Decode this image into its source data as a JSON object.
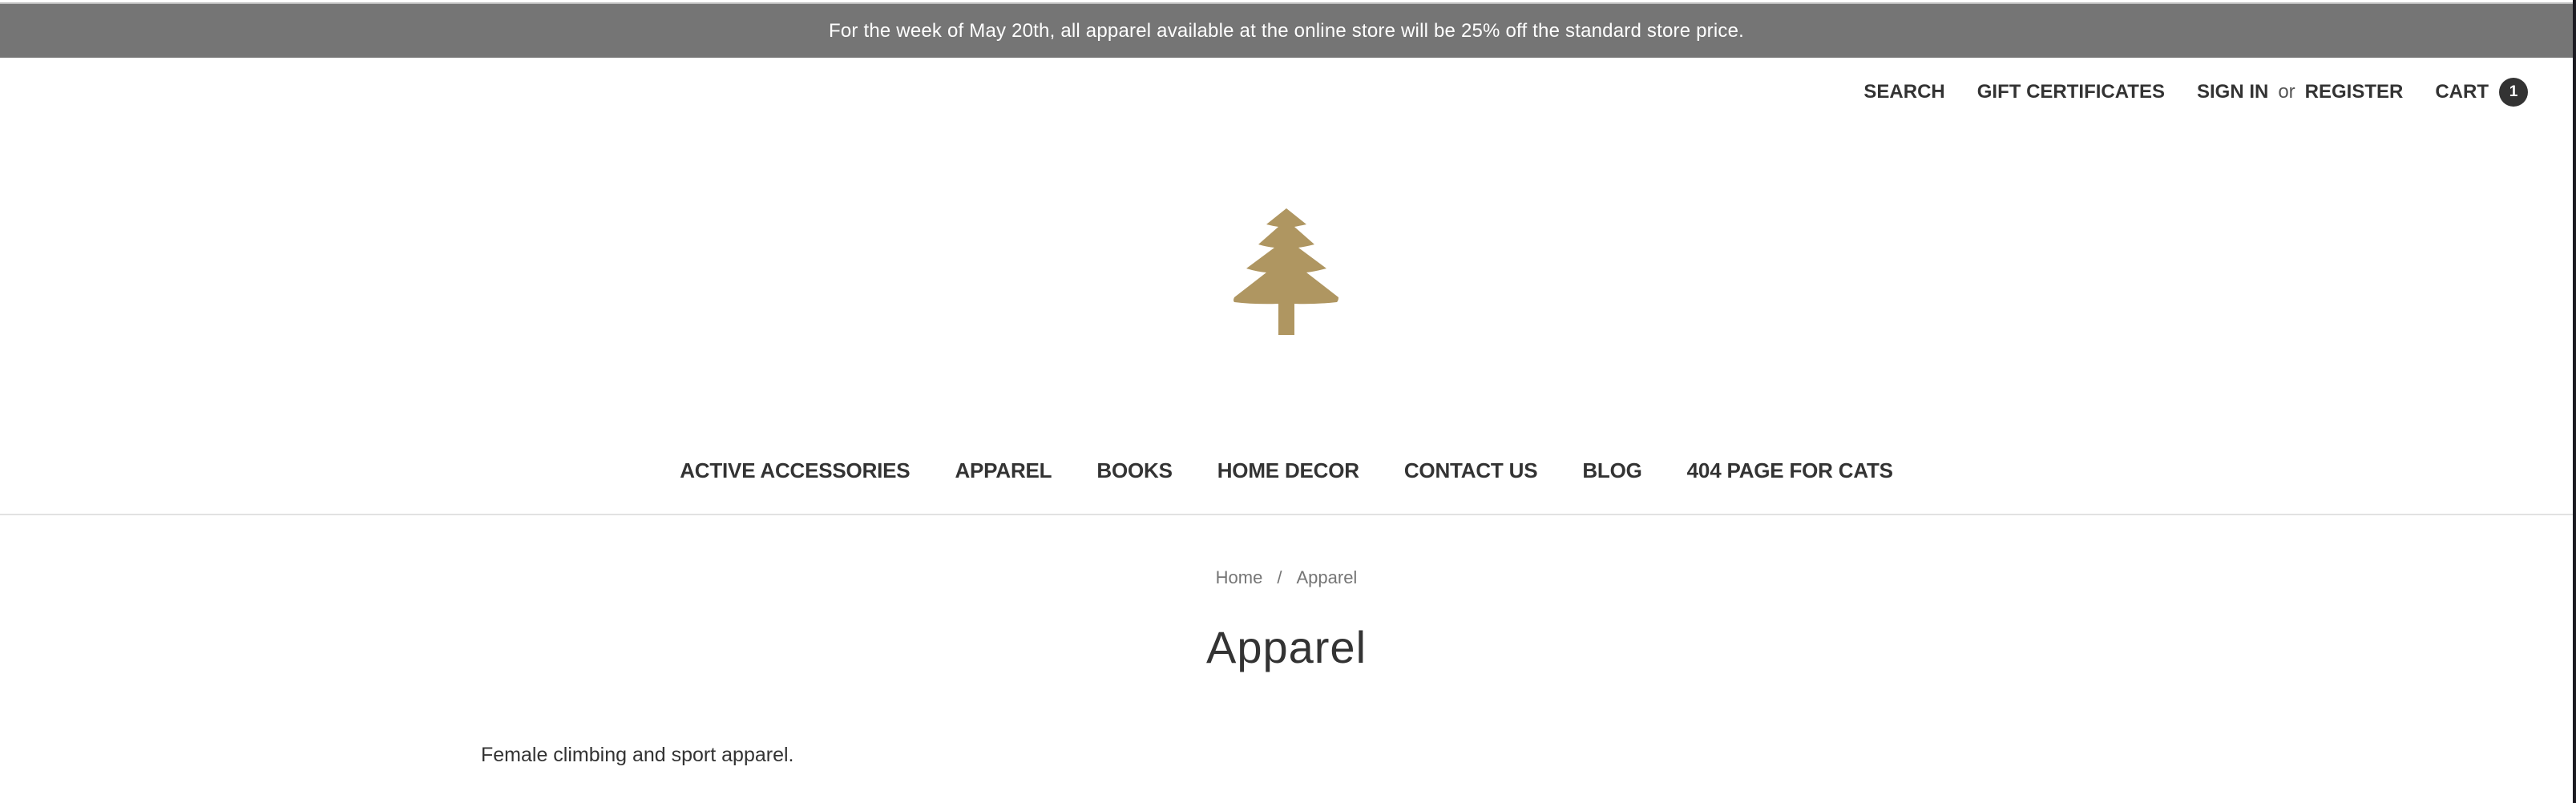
{
  "banner": {
    "text": "For the week of May 20th, all apparel available at the online store will be 25% off the standard store price."
  },
  "top_nav": {
    "search": "SEARCH",
    "gift_certificates": "GIFT CERTIFICATES",
    "sign_in": "SIGN IN",
    "or": "or",
    "register": "REGISTER",
    "cart": "CART",
    "cart_count": "1"
  },
  "logo": {
    "icon": "pine-tree-icon",
    "color": "#af9661"
  },
  "main_nav": {
    "items": [
      {
        "label": "ACTIVE ACCESSORIES"
      },
      {
        "label": "APPAREL"
      },
      {
        "label": "BOOKS"
      },
      {
        "label": "HOME DECOR"
      },
      {
        "label": "CONTACT US"
      },
      {
        "label": "BLOG"
      },
      {
        "label": "404 PAGE FOR CATS"
      }
    ]
  },
  "breadcrumb": {
    "items": [
      "Home",
      "Apparel"
    ],
    "separator": "/"
  },
  "page": {
    "title": "Apparel",
    "description": "Female climbing and sport apparel."
  },
  "colors": {
    "banner_bg": "#757575",
    "text": "#333333",
    "muted": "#757575",
    "brand_gold": "#af9661"
  }
}
